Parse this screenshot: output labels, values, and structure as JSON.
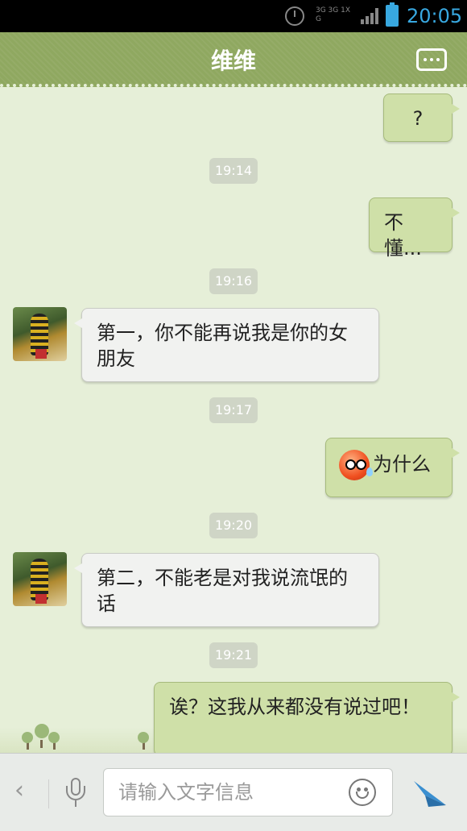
{
  "status_bar": {
    "network": "3G 3G 1X G",
    "time": "20:05"
  },
  "header": {
    "title": "维维"
  },
  "messages": [
    {
      "side": "right",
      "text": "?"
    },
    {
      "timestamp": "19:14"
    },
    {
      "side": "right",
      "text": "不懂..."
    },
    {
      "timestamp": "19:16"
    },
    {
      "side": "left",
      "text": "第一，你不能再说我是你的女朋友"
    },
    {
      "timestamp": "19:17"
    },
    {
      "side": "right",
      "text": "为什么",
      "emoji": "sad-face-emoji"
    },
    {
      "timestamp": "19:20"
    },
    {
      "side": "left",
      "text": "第二，不能老是对我说流氓的话"
    },
    {
      "timestamp": "19:21"
    },
    {
      "side": "right",
      "text": "诶？这我从来都没有说过吧！"
    }
  ],
  "input": {
    "placeholder": "请输入文字信息",
    "value": ""
  },
  "colors": {
    "header": "#8fa860",
    "right_bubble": "#cfe0a8",
    "left_bubble": "#f1f2f0",
    "status_accent": "#38a8e0"
  }
}
